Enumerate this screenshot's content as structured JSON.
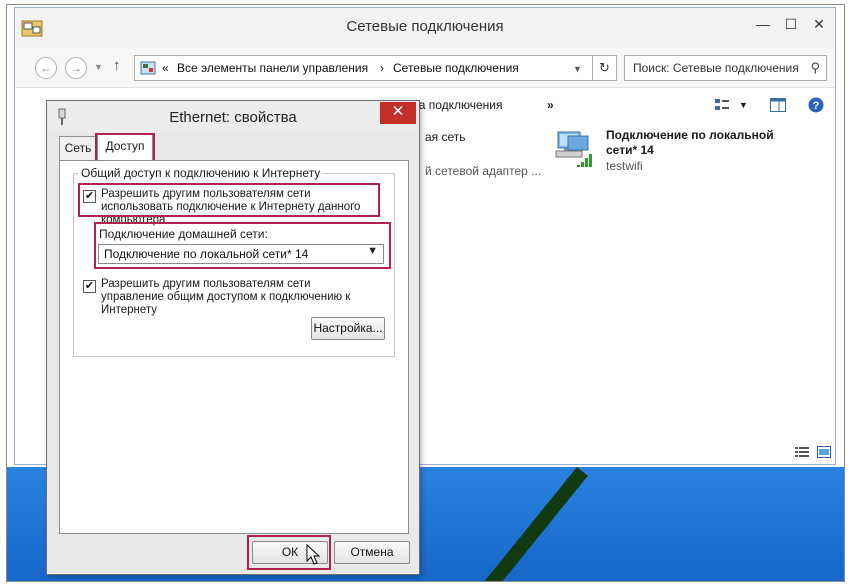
{
  "explorer": {
    "title": "Сетевые подключения",
    "breadcrumb": {
      "overflow": "«",
      "items": [
        "Все элементы панели управления",
        "Сетевые подключения"
      ],
      "separator": "›"
    },
    "search_placeholder": "Поиск: Сетевые подключения",
    "toolbar": {
      "diagnostics_label": "стика подключения",
      "more": "»"
    },
    "items": [
      {
        "line1": "ая сеть",
        "line2": "",
        "line3": "й сетевой адаптер ..."
      },
      {
        "name_line1": "Подключение по локальной",
        "name_line2": "сети* 14",
        "ssid": "testwifi"
      }
    ]
  },
  "dialog": {
    "title": "Ethernet: свойства",
    "close": "✕",
    "tabs": [
      {
        "label": "Сеть",
        "active": false
      },
      {
        "label": "Доступ",
        "active": true
      }
    ],
    "group_title": "Общий доступ к подключению к Интернету",
    "allow_sharing": {
      "checked": true,
      "label": "Разрешить другим пользователям сети использовать подключение к Интернету данного компьютера"
    },
    "home_network": {
      "label": "Подключение домашней сети:",
      "selected": "Подключение по локальной сети* 14"
    },
    "allow_control": {
      "checked": true,
      "label": "Разрешить другим пользователям сети управление общим доступом к подключению к Интернету"
    },
    "settings_button": "Настройка...",
    "ok_button": "ОК",
    "cancel_button": "Отмена"
  },
  "colors": {
    "highlight": "#b1224c",
    "close_red": "#c3302a",
    "desktop_blue": "#1a6fd1"
  }
}
